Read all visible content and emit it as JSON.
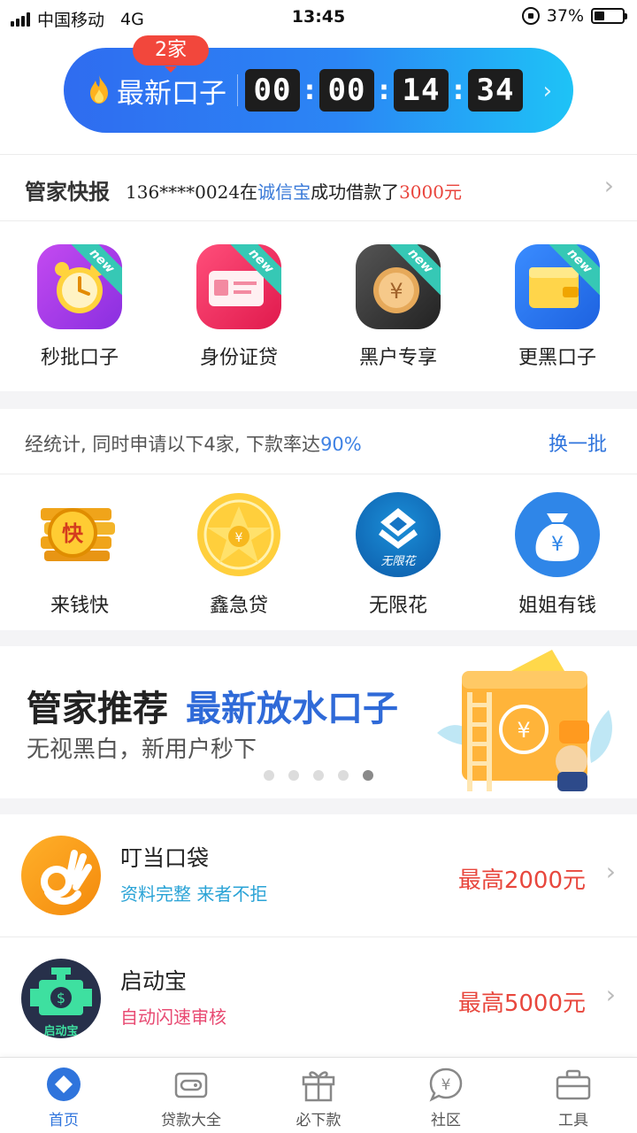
{
  "status_bar": {
    "carrier": "中国移动",
    "network": "4G",
    "time": "13:45",
    "battery": "37%",
    "battery_level": 0.37
  },
  "countdown": {
    "badge": "2家",
    "title": "最新口子",
    "digits": [
      "00",
      "00",
      "14",
      "34"
    ]
  },
  "news": {
    "label": "管家快报",
    "phone": "136****0024在",
    "platform": "诚信宝",
    "action": "成功借款了",
    "amount": "3000元"
  },
  "grid_new": [
    {
      "label": "秒批口子",
      "icon": "alarm-clock-icon",
      "tag": "new",
      "color": "#a83ce8"
    },
    {
      "label": "身份证贷",
      "icon": "id-card-icon",
      "tag": "new",
      "color": "#ee2f6b"
    },
    {
      "label": "黑户专享",
      "icon": "yuan-coin-icon",
      "tag": "new",
      "color": "#333333"
    },
    {
      "label": "更黑口子",
      "icon": "wallet-icon",
      "tag": "new",
      "color": "#2e7bf0"
    }
  ],
  "stats": {
    "text": "经统计, 同时申请以下4家, 下款率达",
    "rate": "90%",
    "swap": "换一批"
  },
  "apps": [
    {
      "label": "来钱快",
      "icon": "gold-coins-icon",
      "logo_text": "快"
    },
    {
      "label": "鑫急贷",
      "icon": "gold-medal-icon"
    },
    {
      "label": "无限花",
      "icon": "wuxianhua-logo-icon",
      "logo_text": "无限花"
    },
    {
      "label": "姐姐有钱",
      "icon": "money-bag-icon"
    }
  ],
  "promo": {
    "title_black": "管家推荐",
    "title_blue": "最新放水口子",
    "subtitle": "无视黑白，新用户秒下",
    "pages": 5,
    "active_page": 5
  },
  "loans": [
    {
      "name": "叮当口袋",
      "tag": "资料完整 来者不拒",
      "tag_color": "#2aa3d6",
      "amount": "最高2000元",
      "icon": "ok-hand-icon"
    },
    {
      "name": "启动宝",
      "tag": "自动闪速审核",
      "tag_color": "#e84a72",
      "amount": "最高5000元",
      "icon": "engine-icon",
      "logo_text": "启动宝"
    }
  ],
  "nav": [
    {
      "label": "首页",
      "icon": "home-diamond-icon",
      "active": true
    },
    {
      "label": "贷款大全",
      "icon": "wallet-outline-icon",
      "active": false
    },
    {
      "label": "必下款",
      "icon": "gift-icon",
      "active": false
    },
    {
      "label": "社区",
      "icon": "chat-yuan-icon",
      "active": false
    },
    {
      "label": "工具",
      "icon": "toolbox-icon",
      "active": false
    }
  ]
}
